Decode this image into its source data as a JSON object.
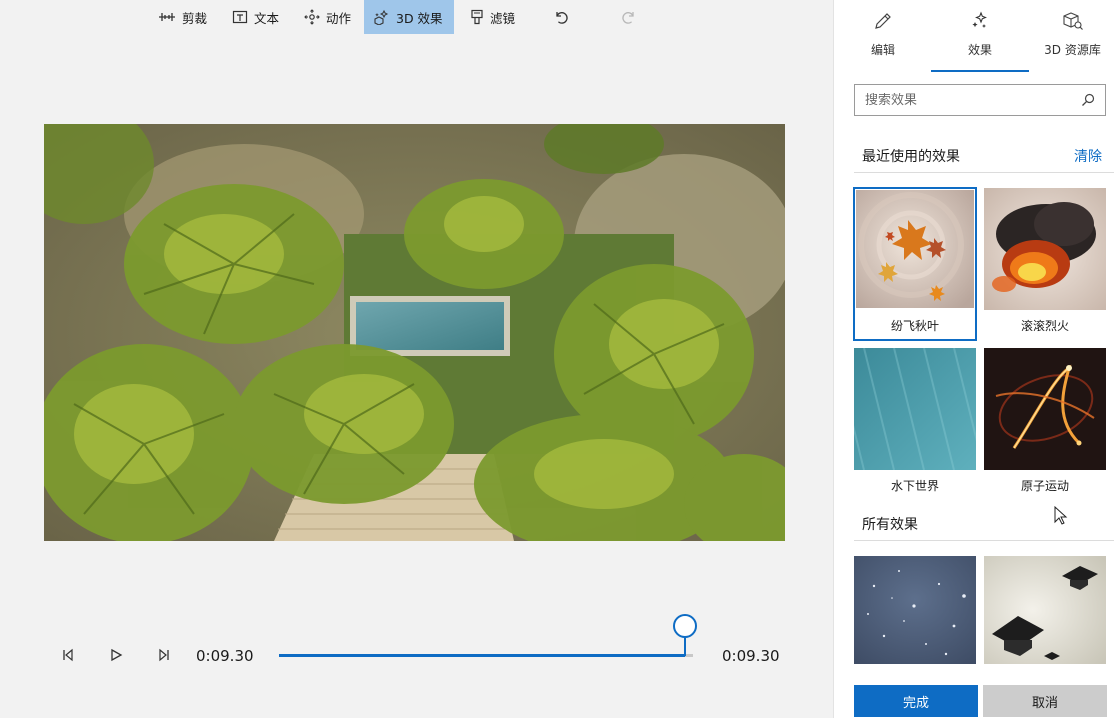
{
  "toolbar": {
    "items": [
      {
        "label": "剪裁",
        "icon": "trim-icon"
      },
      {
        "label": "文本",
        "icon": "text-icon"
      },
      {
        "label": "动作",
        "icon": "motion-icon"
      },
      {
        "label": "3D 效果",
        "icon": "3d-effects-icon",
        "active": true
      },
      {
        "label": "滤镜",
        "icon": "filter-icon"
      }
    ],
    "undo_icon": "undo-icon",
    "redo_icon": "redo-icon"
  },
  "preview": {
    "description_icon": "aerial-palm-garden-video-frame"
  },
  "playback": {
    "current_time": "0:09.30",
    "total_time": "0:09.30",
    "progress": 1.0,
    "prev_frame_icon": "step-back-icon",
    "play_icon": "play-icon",
    "next_frame_icon": "step-forward-icon"
  },
  "panel": {
    "tabs": [
      {
        "label": "编辑",
        "icon": "pencil-icon"
      },
      {
        "label": "效果",
        "icon": "sparkle-icon",
        "active": true
      },
      {
        "label": "3D 资源库",
        "icon": "3d-cube-icon"
      }
    ],
    "search": {
      "placeholder": "搜索效果",
      "value": ""
    },
    "recent_title": "最近使用的效果",
    "clear_label": "清除",
    "recent_effects": [
      {
        "label": "纷飞秋叶",
        "selected": true
      },
      {
        "label": "滚滚烈火"
      },
      {
        "label": "水下世界"
      },
      {
        "label": "原子运动"
      }
    ],
    "all_title": "所有效果",
    "done_label": "完成",
    "cancel_label": "取消"
  },
  "colors": {
    "accent": "#0e6cc4",
    "active_tab_bg": "#9fc6ea"
  }
}
